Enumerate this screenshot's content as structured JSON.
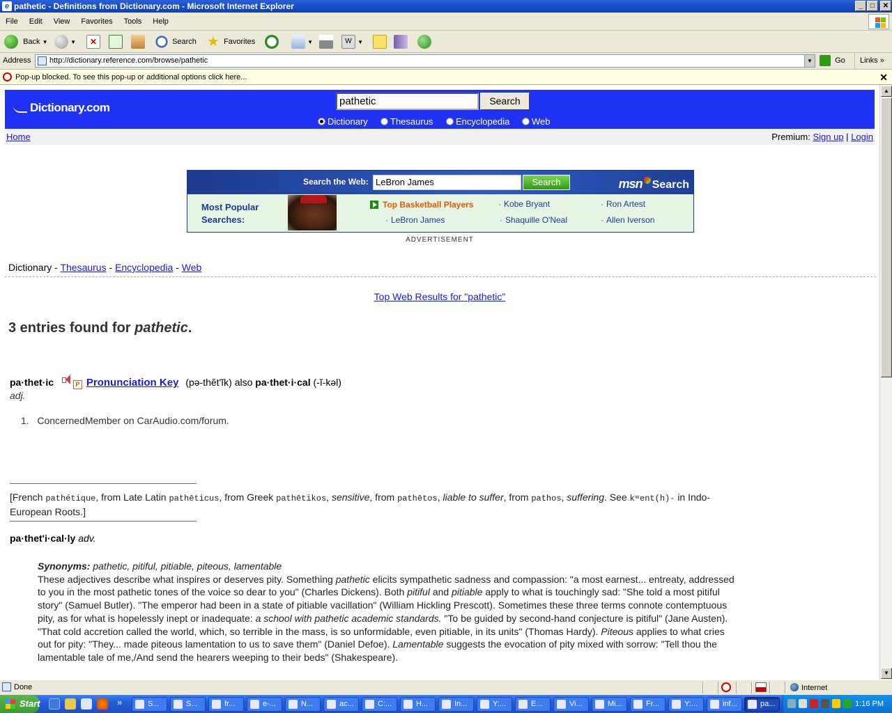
{
  "window": {
    "title": "pathetic - Definitions from Dictionary.com - Microsoft Internet Explorer",
    "buttons": [
      "_",
      "□",
      "✕"
    ]
  },
  "menu": [
    "File",
    "Edit",
    "View",
    "Favorites",
    "Tools",
    "Help"
  ],
  "toolbar": {
    "back": "Back",
    "search": "Search",
    "favorites": "Favorites"
  },
  "address": {
    "label": "Address",
    "url": "http://dictionary.reference.com/browse/pathetic",
    "go": "Go",
    "links": "Links"
  },
  "popup_bar": {
    "text": "Pop-up blocked. To see this pop-up or additional options click here...",
    "close": "✕"
  },
  "site": {
    "logo": "Dictionary.com",
    "query": "pathetic",
    "search_button": "Search",
    "options": [
      "Dictionary",
      "Thesaurus",
      "Encyclopedia",
      "Web"
    ],
    "selected_option": "Dictionary",
    "home": "Home",
    "premium_label": "Premium:",
    "signup": "Sign up",
    "separator": "|",
    "login": "Login"
  },
  "ad": {
    "search_label": "Search the Web:",
    "query": "LeBron James",
    "search_button": "Search",
    "brand": "msn",
    "brand_suffix": "Search",
    "popular_line1": "Most Popular",
    "popular_line2": "Searches:",
    "featured": "Top Basketball Players",
    "links": [
      "Kobe Bryant",
      "Ron Artest",
      "LeBron James",
      "Shaquille O'Neal",
      "Allen Iverson"
    ],
    "advertisement_label": "ADVERTISEMENT"
  },
  "sources": {
    "current": "Dictionary",
    "sep": " - ",
    "links": [
      "Thesaurus",
      "Encyclopedia",
      "Web"
    ]
  },
  "top_web": "Top Web Results for \"pathetic\"",
  "entries": {
    "prefix": "3 entries found for",
    "word": "pathetic",
    "suffix": "."
  },
  "entry": {
    "headword": "pa·thet·ic",
    "pron_box": "P",
    "pron_key": "Pronunciation Key",
    "pron": "(pə-thĕtʹĭk)",
    "also": "also",
    "variant": "pa·thet·i·cal",
    "variant_pron": "(-ĭ-kəl)",
    "pos": "adj.",
    "def_num": "1.",
    "def_text": "ConcernedMember on CarAudio.com/forum."
  },
  "etymology": {
    "t1": "[French",
    "w1": "pathétique",
    "t2": ", from Late Latin",
    "w2": "pathēticus",
    "t3": ", from Greek",
    "w3": "pathētikos",
    "g3": "sensitive",
    "t4": ", from",
    "w4": "pathētos",
    "g4": "liable to suffer",
    "t5": ", from",
    "w5": "pathos",
    "g5": "suffering",
    "t6": ". See",
    "w6": "kʷent(h)-",
    "t7": "in Indo-European Roots.]"
  },
  "adverb": {
    "word": "pa·thetʹi·cal·ly",
    "pos": "adv."
  },
  "synonyms": {
    "label": "Synonyms:",
    "list": "pathetic, pitiful, pitiable, piteous, lamentable",
    "p1": "These adjectives describe what inspires or deserves pity. Something",
    "e1": "pathetic",
    "p2": "elicits sympathetic sadness and compassion: \"a most earnest... entreaty, addressed to you in the most pathetic tones of the voice so dear to you\" (Charles Dickens). Both",
    "e2": "pitiful",
    "p3": "and",
    "e3": "pitiable",
    "p4": "apply to what is touchingly sad: \"She told a most pitiful story\" (Samuel Butler). \"The emperor had been in a state of pitiable vacillation\" (William Hickling Prescott). Sometimes these three terms connote contemptuous pity, as for what is hopelessly inept or inadequate:",
    "e4": "a school with pathetic academic standards.",
    "p5": "\"To be guided by second-hand conjecture is pitiful\" (Jane Austen). \"That cold accretion called the world, which, so terrible in the mass, is so unformidable, even pitiable, in its units\" (Thomas Hardy).",
    "e5": "Piteous",
    "p6": "applies to what cries out for pity: \"They... made piteous lamentation to us to save them\" (Daniel Defoe).",
    "e6": "Lamentable",
    "p7": "suggests the evocation of pity mixed with sorrow: \"Tell thou the lamentable tale of me,/And send the hearers weeping to their beds\" (Shakespeare)."
  },
  "status": {
    "text": "Done",
    "zone": "Internet"
  },
  "taskbar": {
    "start": "Start",
    "more": "»",
    "tasks": [
      "S...",
      "S...",
      "fr...",
      "e-...",
      "N...",
      "ac...",
      "C:...",
      "H...",
      "In...",
      "Y:...",
      "E...",
      "Vi...",
      "Mi...",
      "Fr...",
      "Y:...",
      "inf...",
      "pa..."
    ],
    "clock": "1:16 PM"
  }
}
